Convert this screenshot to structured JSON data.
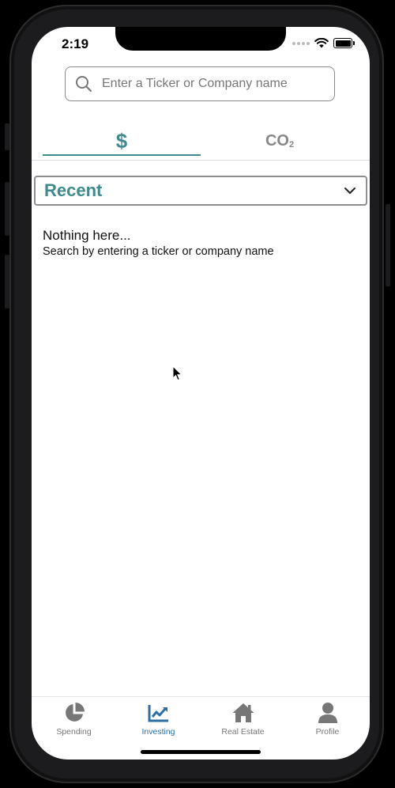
{
  "status_bar": {
    "time": "2:19"
  },
  "search": {
    "placeholder": "Enter a Ticker or Company name"
  },
  "tabs": [
    {
      "label": "$",
      "active": true
    },
    {
      "label": "CO",
      "subscript": "2",
      "active": false
    }
  ],
  "filter": {
    "selected": "Recent"
  },
  "empty_state": {
    "title": "Nothing here...",
    "subtitle": "Search by entering a ticker or company name"
  },
  "bottom_nav": [
    {
      "label": "Spending",
      "icon": "pie-chart-icon",
      "active": false
    },
    {
      "label": "Investing",
      "icon": "line-chart-icon",
      "active": true
    },
    {
      "label": "Real Estate",
      "icon": "home-icon",
      "active": false
    },
    {
      "label": "Profile",
      "icon": "user-icon",
      "active": false
    }
  ],
  "colors": {
    "accent_teal": "#3f8a8c",
    "nav_active": "#2e6fa8",
    "nav_inactive": "#777777"
  }
}
